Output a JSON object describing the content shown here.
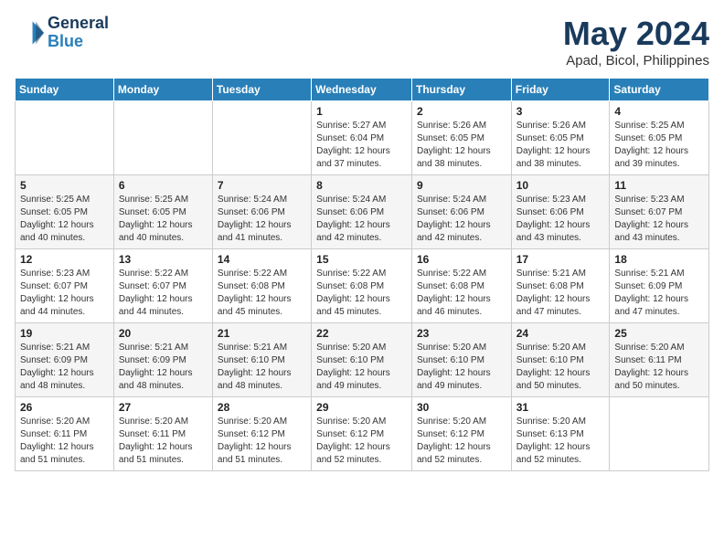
{
  "logo": {
    "line1": "General",
    "line2": "Blue"
  },
  "title": "May 2024",
  "location": "Apad, Bicol, Philippines",
  "weekdays": [
    "Sunday",
    "Monday",
    "Tuesday",
    "Wednesday",
    "Thursday",
    "Friday",
    "Saturday"
  ],
  "weeks": [
    [
      {
        "day": "",
        "info": ""
      },
      {
        "day": "",
        "info": ""
      },
      {
        "day": "",
        "info": ""
      },
      {
        "day": "1",
        "info": "Sunrise: 5:27 AM\nSunset: 6:04 PM\nDaylight: 12 hours and 37 minutes."
      },
      {
        "day": "2",
        "info": "Sunrise: 5:26 AM\nSunset: 6:05 PM\nDaylight: 12 hours and 38 minutes."
      },
      {
        "day": "3",
        "info": "Sunrise: 5:26 AM\nSunset: 6:05 PM\nDaylight: 12 hours and 38 minutes."
      },
      {
        "day": "4",
        "info": "Sunrise: 5:25 AM\nSunset: 6:05 PM\nDaylight: 12 hours and 39 minutes."
      }
    ],
    [
      {
        "day": "5",
        "info": "Sunrise: 5:25 AM\nSunset: 6:05 PM\nDaylight: 12 hours and 40 minutes."
      },
      {
        "day": "6",
        "info": "Sunrise: 5:25 AM\nSunset: 6:05 PM\nDaylight: 12 hours and 40 minutes."
      },
      {
        "day": "7",
        "info": "Sunrise: 5:24 AM\nSunset: 6:06 PM\nDaylight: 12 hours and 41 minutes."
      },
      {
        "day": "8",
        "info": "Sunrise: 5:24 AM\nSunset: 6:06 PM\nDaylight: 12 hours and 42 minutes."
      },
      {
        "day": "9",
        "info": "Sunrise: 5:24 AM\nSunset: 6:06 PM\nDaylight: 12 hours and 42 minutes."
      },
      {
        "day": "10",
        "info": "Sunrise: 5:23 AM\nSunset: 6:06 PM\nDaylight: 12 hours and 43 minutes."
      },
      {
        "day": "11",
        "info": "Sunrise: 5:23 AM\nSunset: 6:07 PM\nDaylight: 12 hours and 43 minutes."
      }
    ],
    [
      {
        "day": "12",
        "info": "Sunrise: 5:23 AM\nSunset: 6:07 PM\nDaylight: 12 hours and 44 minutes."
      },
      {
        "day": "13",
        "info": "Sunrise: 5:22 AM\nSunset: 6:07 PM\nDaylight: 12 hours and 44 minutes."
      },
      {
        "day": "14",
        "info": "Sunrise: 5:22 AM\nSunset: 6:08 PM\nDaylight: 12 hours and 45 minutes."
      },
      {
        "day": "15",
        "info": "Sunrise: 5:22 AM\nSunset: 6:08 PM\nDaylight: 12 hours and 45 minutes."
      },
      {
        "day": "16",
        "info": "Sunrise: 5:22 AM\nSunset: 6:08 PM\nDaylight: 12 hours and 46 minutes."
      },
      {
        "day": "17",
        "info": "Sunrise: 5:21 AM\nSunset: 6:08 PM\nDaylight: 12 hours and 47 minutes."
      },
      {
        "day": "18",
        "info": "Sunrise: 5:21 AM\nSunset: 6:09 PM\nDaylight: 12 hours and 47 minutes."
      }
    ],
    [
      {
        "day": "19",
        "info": "Sunrise: 5:21 AM\nSunset: 6:09 PM\nDaylight: 12 hours and 48 minutes."
      },
      {
        "day": "20",
        "info": "Sunrise: 5:21 AM\nSunset: 6:09 PM\nDaylight: 12 hours and 48 minutes."
      },
      {
        "day": "21",
        "info": "Sunrise: 5:21 AM\nSunset: 6:10 PM\nDaylight: 12 hours and 48 minutes."
      },
      {
        "day": "22",
        "info": "Sunrise: 5:20 AM\nSunset: 6:10 PM\nDaylight: 12 hours and 49 minutes."
      },
      {
        "day": "23",
        "info": "Sunrise: 5:20 AM\nSunset: 6:10 PM\nDaylight: 12 hours and 49 minutes."
      },
      {
        "day": "24",
        "info": "Sunrise: 5:20 AM\nSunset: 6:10 PM\nDaylight: 12 hours and 50 minutes."
      },
      {
        "day": "25",
        "info": "Sunrise: 5:20 AM\nSunset: 6:11 PM\nDaylight: 12 hours and 50 minutes."
      }
    ],
    [
      {
        "day": "26",
        "info": "Sunrise: 5:20 AM\nSunset: 6:11 PM\nDaylight: 12 hours and 51 minutes."
      },
      {
        "day": "27",
        "info": "Sunrise: 5:20 AM\nSunset: 6:11 PM\nDaylight: 12 hours and 51 minutes."
      },
      {
        "day": "28",
        "info": "Sunrise: 5:20 AM\nSunset: 6:12 PM\nDaylight: 12 hours and 51 minutes."
      },
      {
        "day": "29",
        "info": "Sunrise: 5:20 AM\nSunset: 6:12 PM\nDaylight: 12 hours and 52 minutes."
      },
      {
        "day": "30",
        "info": "Sunrise: 5:20 AM\nSunset: 6:12 PM\nDaylight: 12 hours and 52 minutes."
      },
      {
        "day": "31",
        "info": "Sunrise: 5:20 AM\nSunset: 6:13 PM\nDaylight: 12 hours and 52 minutes."
      },
      {
        "day": "",
        "info": ""
      }
    ]
  ]
}
